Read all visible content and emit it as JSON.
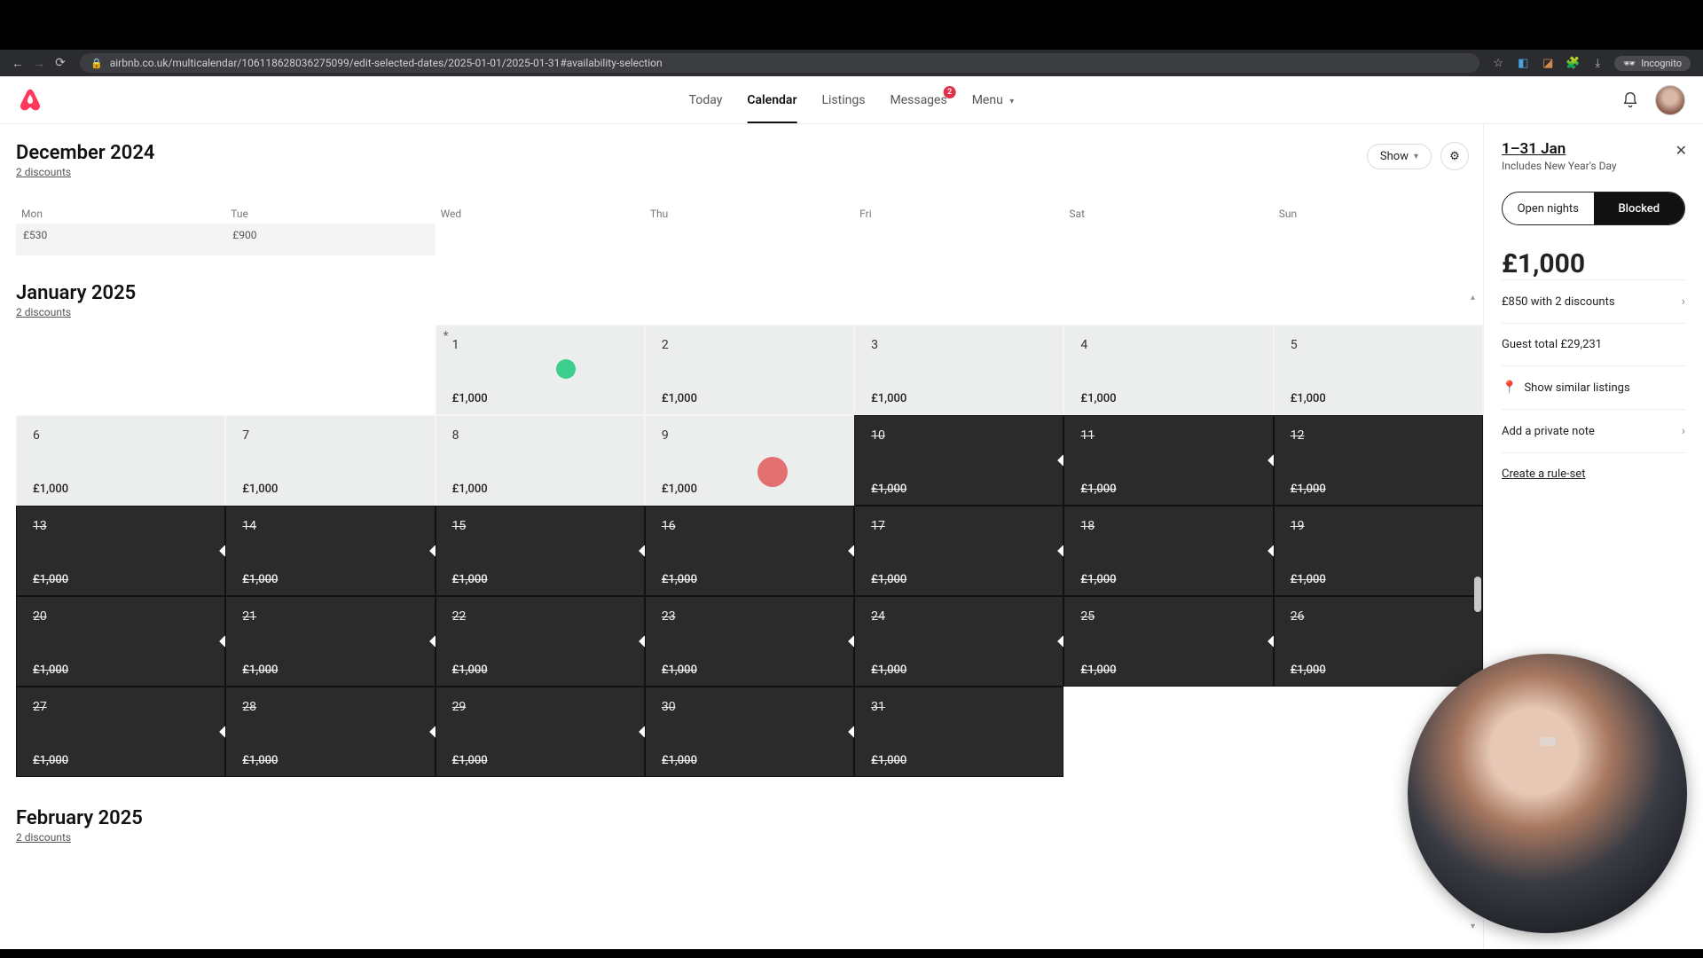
{
  "browser": {
    "url": "airbnb.co.uk/multicalendar/106118628036275099/edit-selected-dates/2025-01-01/2025-01-31#availability-selection",
    "incognito_label": "Incognito"
  },
  "nav": {
    "today": "Today",
    "calendar": "Calendar",
    "listings": "Listings",
    "messages": "Messages",
    "messages_badge": "2",
    "menu": "Menu"
  },
  "controls": {
    "show": "Show"
  },
  "months": {
    "dec": {
      "title": "December 2024",
      "discounts": "2 discounts"
    },
    "jan": {
      "title": "January 2025",
      "discounts": "2 discounts"
    },
    "feb": {
      "title": "February 2025",
      "discounts": "2 discounts"
    }
  },
  "weekdays": [
    "Mon",
    "Tue",
    "Wed",
    "Thu",
    "Fri",
    "Sat",
    "Sun"
  ],
  "dec_tail": [
    "£530",
    "£900",
    "",
    "",
    "",
    "",
    ""
  ],
  "jan": {
    "price": "£1,000",
    "days": [
      {
        "n": 1,
        "col": 3,
        "state": "open",
        "ast": true,
        "green": true
      },
      {
        "n": 2,
        "col": 4,
        "state": "open"
      },
      {
        "n": 3,
        "col": 5,
        "state": "open"
      },
      {
        "n": 4,
        "col": 6,
        "state": "open"
      },
      {
        "n": 5,
        "col": 7,
        "state": "open"
      },
      {
        "n": 6,
        "col": 1,
        "state": "open"
      },
      {
        "n": 7,
        "col": 2,
        "state": "open"
      },
      {
        "n": 8,
        "col": 3,
        "state": "open"
      },
      {
        "n": 9,
        "col": 4,
        "state": "open",
        "red": true
      },
      {
        "n": 10,
        "col": 5,
        "state": "blocked",
        "next": true
      },
      {
        "n": 11,
        "col": 6,
        "state": "blocked",
        "next": true
      },
      {
        "n": 12,
        "col": 7,
        "state": "blocked"
      },
      {
        "n": 13,
        "col": 1,
        "state": "blocked",
        "next": true
      },
      {
        "n": 14,
        "col": 2,
        "state": "blocked",
        "next": true
      },
      {
        "n": 15,
        "col": 3,
        "state": "blocked",
        "next": true
      },
      {
        "n": 16,
        "col": 4,
        "state": "blocked",
        "next": true
      },
      {
        "n": 17,
        "col": 5,
        "state": "blocked",
        "next": true
      },
      {
        "n": 18,
        "col": 6,
        "state": "blocked",
        "next": true
      },
      {
        "n": 19,
        "col": 7,
        "state": "blocked"
      },
      {
        "n": 20,
        "col": 1,
        "state": "blocked",
        "next": true
      },
      {
        "n": 21,
        "col": 2,
        "state": "blocked",
        "next": true
      },
      {
        "n": 22,
        "col": 3,
        "state": "blocked",
        "next": true
      },
      {
        "n": 23,
        "col": 4,
        "state": "blocked",
        "next": true
      },
      {
        "n": 24,
        "col": 5,
        "state": "blocked",
        "next": true
      },
      {
        "n": 25,
        "col": 6,
        "state": "blocked",
        "next": true
      },
      {
        "n": 26,
        "col": 7,
        "state": "blocked"
      },
      {
        "n": 27,
        "col": 1,
        "state": "blocked",
        "next": true
      },
      {
        "n": 28,
        "col": 2,
        "state": "blocked",
        "next": true
      },
      {
        "n": 29,
        "col": 3,
        "state": "blocked",
        "next": true
      },
      {
        "n": 30,
        "col": 4,
        "state": "blocked",
        "next": true
      },
      {
        "n": 31,
        "col": 5,
        "state": "blocked"
      }
    ]
  },
  "side": {
    "title": "1–31 Jan",
    "subtitle": "Includes New Year's Day",
    "open": "Open nights",
    "blocked": "Blocked",
    "price": "£1,000",
    "discount_row": "£850 with 2 discounts",
    "guest_total": "Guest total £29,231",
    "similar": "Show similar listings",
    "note": "Add a private note",
    "ruleset": "Create a rule-set"
  }
}
